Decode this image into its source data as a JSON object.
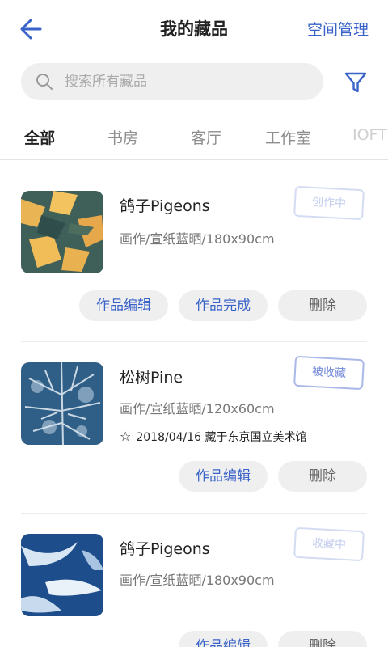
{
  "header": {
    "title": "我的藏品",
    "right_action": "空间管理"
  },
  "search": {
    "placeholder": "搜索所有藏品"
  },
  "tabs": [
    {
      "label": "全部",
      "active": true
    },
    {
      "label": "书房",
      "active": false
    },
    {
      "label": "客厅",
      "active": false
    },
    {
      "label": "工作室",
      "active": false
    },
    {
      "label": "IOFT",
      "active": false
    }
  ],
  "items": [
    {
      "name": "鸽子Pigeons",
      "meta": "画作/宣纸蓝晒/180x90cm",
      "stamp": "创作中",
      "buttons": [
        "作品编辑",
        "作品完成",
        "删除"
      ]
    },
    {
      "name": "松树Pine",
      "meta": "画作/宣纸蓝晒/120x60cm",
      "favorite": "2018/04/16 藏于东京国立美术馆",
      "stamp": "被收藏",
      "buttons": [
        "作品编辑",
        "删除"
      ]
    },
    {
      "name": "鸽子Pigeons",
      "meta": "画作/宣纸蓝晒/180x90cm",
      "stamp": "收藏中",
      "buttons": [
        "作品编辑",
        "删除"
      ]
    }
  ],
  "colors": {
    "accent": "#3a63c9",
    "stamp_light": "#c3cdee",
    "button_bg": "#efefef"
  },
  "icons": {
    "back": "back-arrow-icon",
    "search": "search-icon",
    "filter": "filter-icon",
    "favorite": "star-outline-icon"
  }
}
